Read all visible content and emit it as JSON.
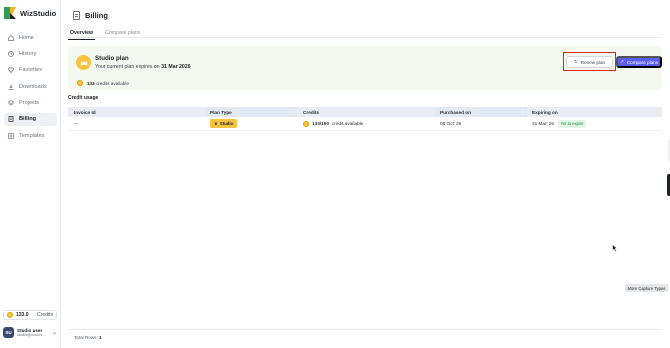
{
  "app": {
    "name": "WizStudio"
  },
  "sidebar": {
    "items": [
      {
        "label": "Home",
        "icon": "home-icon"
      },
      {
        "label": "History",
        "icon": "history-icon"
      },
      {
        "label": "Favorites",
        "icon": "heart-icon"
      },
      {
        "label": "Downloads",
        "icon": "download-icon"
      },
      {
        "label": "Projects",
        "icon": "layers-icon"
      },
      {
        "label": "Billing",
        "icon": "billing-icon",
        "active": true
      },
      {
        "label": "Templates",
        "icon": "grid-icon"
      }
    ],
    "credits": {
      "value": "133.0",
      "label": "Credits"
    },
    "user": {
      "initials": "SU",
      "name": "Studio user",
      "email": "studio@xxxxxx..."
    }
  },
  "page": {
    "title": "Billing",
    "tabs": [
      {
        "label": "Overview",
        "active": true
      },
      {
        "label": "Compare plans",
        "active": false
      }
    ]
  },
  "plan": {
    "title": "Studio plan",
    "expiry_prefix": "Your current plan expires on",
    "expiry_date": "31 Mar 2026",
    "credits_count": "133",
    "credits_suffix": "credits available",
    "renew_label": "Renew plan",
    "compare_label": "Compare plans"
  },
  "credit_usage": {
    "title": "Credit usage",
    "columns": [
      "Invoice Id",
      "Plan Type",
      "Credits",
      "Purchased on",
      "Expiring on"
    ],
    "rows": [
      {
        "invoice_id": "---",
        "plan_type": "Studio",
        "credits": "133/150",
        "credits_suffix": "credit available",
        "purchased_on": "08 Oct' 25",
        "expiring_on": "31 Mar' 26",
        "status": "Yet to expire"
      }
    ],
    "total_rows_label": "Total Rows:",
    "total_rows": "1"
  },
  "overlay": {
    "capture_tip": "More Capture Types"
  },
  "colors": {
    "accent": "#5b5cf0",
    "gold": "#f6c343",
    "highlight": "#e02424",
    "card_bg": "#f4f9ef"
  }
}
